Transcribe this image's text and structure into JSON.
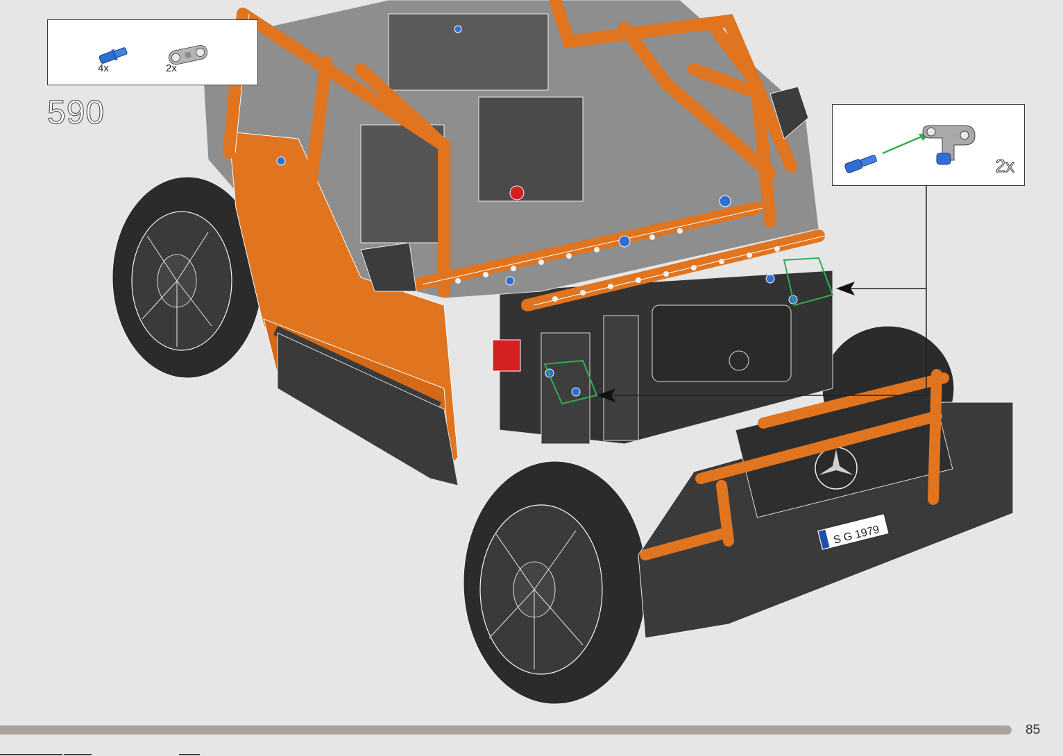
{
  "step": {
    "number": "590"
  },
  "parts_list": {
    "items": [
      {
        "icon": "blue-axle-pin-icon",
        "qty": "4x",
        "color": "#2f6fd1"
      },
      {
        "icon": "gray-double-pin-connector-icon",
        "qty": "2x",
        "color": "#9a9a9a"
      }
    ]
  },
  "sub_assembly": {
    "qty": "2x",
    "arrow_color": "#2fae4e",
    "parts": [
      "blue-axle-pin-icon",
      "gray-angled-connector-icon"
    ]
  },
  "model": {
    "license_plate": "S G 1979",
    "body_color": "#e0741f",
    "frame_color": "#3c3c3c",
    "highlight_color": "#2fae4e"
  },
  "footer": {
    "page_number": "85",
    "progress_color": "#a8a29b"
  }
}
